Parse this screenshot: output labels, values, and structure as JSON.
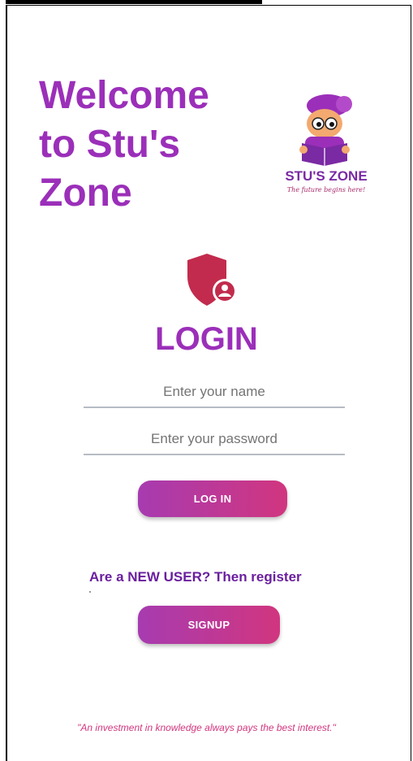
{
  "header": {
    "welcome_line1": "Welcome",
    "welcome_line2": "to Stu's",
    "welcome_line3": "Zone"
  },
  "logo": {
    "icon": "student-reading-book-icon",
    "brand": "STU'S ZONE",
    "tagline": "The future begins here!"
  },
  "login": {
    "icon": "shield-user-icon",
    "title": "LOGIN",
    "name_placeholder": "Enter your name",
    "name_value": "",
    "password_placeholder": "Enter your password",
    "password_value": "",
    "button_label": "LOG IN"
  },
  "register": {
    "prompt": "Are a NEW USER? Then register",
    "button_label": "SIGNUP"
  },
  "footer": {
    "quote": "\"An investment in knowledge always pays the best interest.\""
  },
  "colors": {
    "primary_purple": "#9b2fb9",
    "dark_purple": "#6a1f9e",
    "accent_pink": "#d1367f",
    "shield_red": "#c22b4d"
  }
}
